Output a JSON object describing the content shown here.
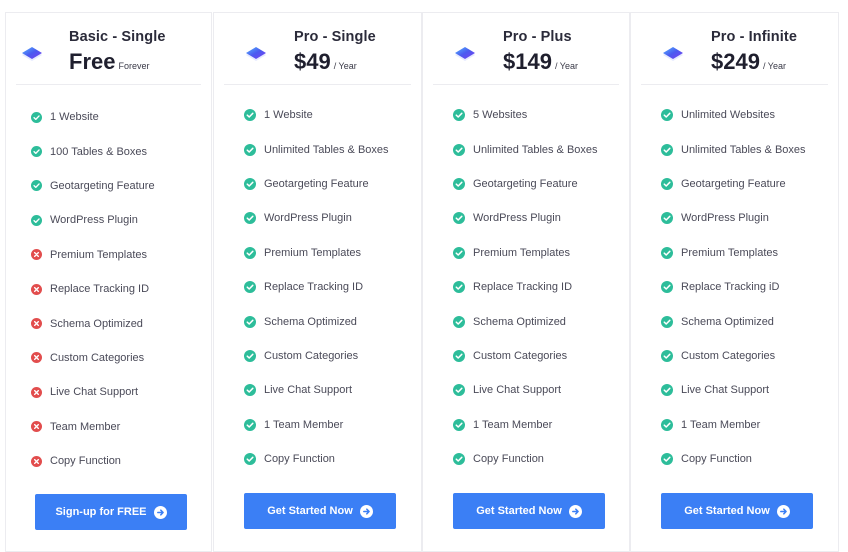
{
  "colors": {
    "accent": "#3b7ff5",
    "included": "#2dbd9a",
    "excluded": "#e24d4d"
  },
  "plans": [
    {
      "name": "Basic - Single",
      "price": "Free",
      "period": "Forever",
      "cta": "Sign-up for FREE",
      "icon": "layers-logo-icon",
      "features": [
        {
          "label": "1 Website",
          "included": true
        },
        {
          "label": "100 Tables & Boxes",
          "included": true
        },
        {
          "label": "Geotargeting Feature",
          "included": true
        },
        {
          "label": "WordPress Plugin",
          "included": true
        },
        {
          "label": "Premium Templates",
          "included": false
        },
        {
          "label": "Replace Tracking ID",
          "included": false
        },
        {
          "label": "Schema Optimized",
          "included": false
        },
        {
          "label": "Custom Categories",
          "included": false
        },
        {
          "label": "Live Chat Support",
          "included": false
        },
        {
          "label": "Team Member",
          "included": false
        },
        {
          "label": "Copy Function",
          "included": false
        }
      ]
    },
    {
      "name": "Pro - Single",
      "price": "$49",
      "period": "/ Year",
      "cta": "Get Started Now",
      "icon": "layers-logo-icon",
      "features": [
        {
          "label": "1 Website",
          "included": true
        },
        {
          "label": "Unlimited Tables & Boxes",
          "included": true
        },
        {
          "label": "Geotargeting Feature",
          "included": true
        },
        {
          "label": "WordPress Plugin",
          "included": true
        },
        {
          "label": "Premium Templates",
          "included": true
        },
        {
          "label": "Replace Tracking ID",
          "included": true
        },
        {
          "label": "Schema Optimized",
          "included": true
        },
        {
          "label": "Custom Categories",
          "included": true
        },
        {
          "label": "Live Chat Support",
          "included": true
        },
        {
          "label": "1 Team Member",
          "included": true
        },
        {
          "label": "Copy Function",
          "included": true
        }
      ]
    },
    {
      "name": "Pro - Plus",
      "price": "$149",
      "period": "/ Year",
      "cta": "Get Started Now",
      "icon": "layers-logo-icon",
      "features": [
        {
          "label": "5 Websites",
          "included": true
        },
        {
          "label": "Unlimited Tables & Boxes",
          "included": true
        },
        {
          "label": "Geotargeting Feature",
          "included": true
        },
        {
          "label": "WordPress Plugin",
          "included": true
        },
        {
          "label": "Premium Templates",
          "included": true
        },
        {
          "label": "Replace Tracking ID",
          "included": true
        },
        {
          "label": "Schema Optimized",
          "included": true
        },
        {
          "label": "Custom Categories",
          "included": true
        },
        {
          "label": "Live Chat Support",
          "included": true
        },
        {
          "label": "1 Team Member",
          "included": true
        },
        {
          "label": "Copy Function",
          "included": true
        }
      ]
    },
    {
      "name": "Pro - Infinite",
      "price": "$249",
      "period": "/ Year",
      "cta": "Get Started Now",
      "icon": "layers-logo-icon",
      "features": [
        {
          "label": "Unlimited Websites",
          "included": true
        },
        {
          "label": "Unlimited Tables & Boxes",
          "included": true
        },
        {
          "label": "Geotargeting Feature",
          "included": true
        },
        {
          "label": "WordPress Plugin",
          "included": true
        },
        {
          "label": "Premium Templates",
          "included": true
        },
        {
          "label": "Replace Tracking iD",
          "included": true
        },
        {
          "label": "Schema Optimized",
          "included": true
        },
        {
          "label": "Custom Categories",
          "included": true
        },
        {
          "label": "Live Chat Support",
          "included": true
        },
        {
          "label": "1 Team Member",
          "included": true
        },
        {
          "label": "Copy Function",
          "included": true
        }
      ]
    }
  ]
}
